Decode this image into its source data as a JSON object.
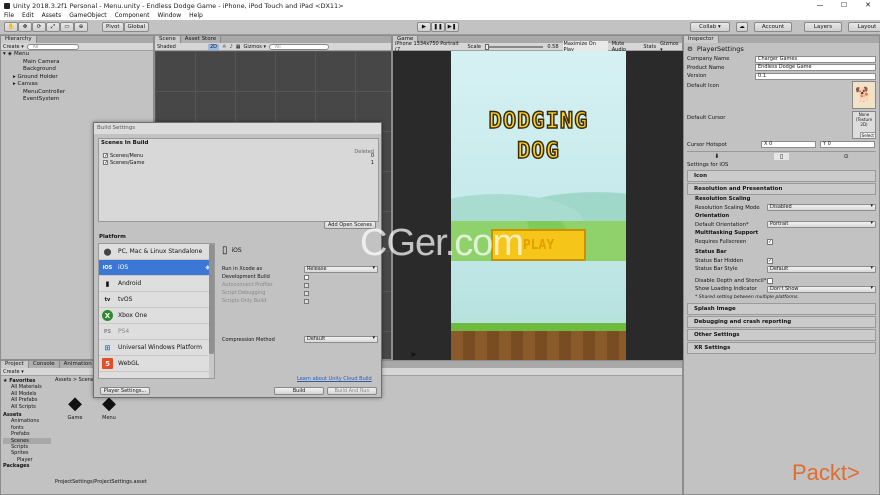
{
  "window": {
    "title": "Unity 2018.3.2f1 Personal - Menu.unity - Endless Dodge Game - iPhone, iPod Touch and iPad <DX11>",
    "controls": [
      "—",
      "☐",
      "✕"
    ]
  },
  "menu": [
    "File",
    "Edit",
    "Assets",
    "GameObject",
    "Component",
    "Window",
    "Help"
  ],
  "toolbar": {
    "pivot": "Pivot",
    "global": "Global",
    "collab": "Collab ▾",
    "account": "Account",
    "layers": "Layers",
    "layout": "Layout"
  },
  "hierarchy": {
    "tab": "Hierarchy",
    "create": "Create ▾",
    "search": "All",
    "scene": "Menu",
    "items": [
      "Main Camera",
      "Background",
      "Ground Holder",
      "Canvas",
      "MenuController",
      "EventSystem"
    ]
  },
  "scene": {
    "tab": "Scene",
    "asset_store": "Asset Store",
    "shading": "Shaded",
    "mode": "2D",
    "gizmos": "Gizmos ▾",
    "search": "All"
  },
  "game": {
    "tab": "Game",
    "resolution": "iPhone 1334x750 Portrait (7",
    "scale_label": "Scale",
    "scale_value": "0.58",
    "maximize": "Maximize On Play",
    "mute": "Mute Audio",
    "stats": "Stats",
    "gizmos": "Gizmos ▾",
    "logo_line1": "DODGING",
    "logo_line2": "DOG",
    "play": "PLAY"
  },
  "project": {
    "tabs": [
      "Project",
      "Console",
      "Animation"
    ],
    "create": "Create ▾",
    "favorites": "Favorites",
    "fav_items": [
      "All Materials",
      "All Models",
      "All Prefabs",
      "All Scripts"
    ],
    "assets": "Assets",
    "asset_items": [
      "Animations",
      "fonts",
      "Prefabs",
      "Scenes",
      "Scripts",
      "Sprites",
      "Player"
    ],
    "packages": "Packages",
    "path": "Assets > Scenes",
    "files": [
      "Game",
      "Menu"
    ],
    "status": "ProjectSettings/ProjectSettings.asset"
  },
  "build": {
    "title": "Build Settings",
    "scenes_header": "Scenes In Build",
    "deleted": "Deleted",
    "scenes": [
      {
        "name": "Scenes/Menu",
        "index": "0"
      },
      {
        "name": "Scenes/Game",
        "index": "1"
      }
    ],
    "add_open": "Add Open Scenes",
    "platform_header": "Platform",
    "platforms": [
      {
        "icon": "⬤",
        "name": "PC, Mac & Linux Standalone"
      },
      {
        "icon": "iOS",
        "name": "iOS"
      },
      {
        "icon": "▮",
        "name": "Android"
      },
      {
        "icon": "tv",
        "name": "tvOS"
      },
      {
        "icon": "X",
        "name": "Xbox One"
      },
      {
        "icon": "PS",
        "name": "PS4"
      },
      {
        "icon": "⊞",
        "name": "Universal Windows Platform"
      },
      {
        "icon": "5",
        "name": "WebGL"
      }
    ],
    "selected_name": "iOS",
    "options": [
      {
        "label": "Run in Xcode as",
        "value": "Release"
      },
      {
        "label": "Development Build",
        "value": ""
      },
      {
        "label": "Autoconnect Profiler",
        "value": ""
      },
      {
        "label": "Script Debugging",
        "value": ""
      },
      {
        "label": "Scripts Only Build",
        "value": ""
      }
    ],
    "compression_label": "Compression Method",
    "compression_value": "Default",
    "cloud_link": "Learn about Unity Cloud Build",
    "player_settings": "Player Settings...",
    "build": "Build",
    "build_run": "Build And Run"
  },
  "inspector": {
    "tab": "Inspector",
    "title": "PlayerSettings",
    "fields": [
      {
        "label": "Company Name",
        "value": "Charger Games"
      },
      {
        "label": "Product Name",
        "value": "Endless Dodge Game"
      },
      {
        "label": "Version",
        "value": "0.1"
      }
    ],
    "default_icon": "Default Icon",
    "default_cursor": "Default Cursor",
    "cursor_none": "None (Texture 2D)",
    "select": "Select",
    "cursor_hotspot": "Cursor Hotspot",
    "hotspot_x": "X 0",
    "hotspot_y": "Y 0",
    "settings_for": "Settings for iOS",
    "sections": {
      "icon": "Icon",
      "resolution": "Resolution and Presentation",
      "res_scaling": "Resolution Scaling",
      "res_scaling_mode_label": "Resolution Scaling Mode",
      "res_scaling_mode": "Disabled",
      "orientation": "Orientation",
      "default_orientation_label": "Default Orientation*",
      "default_orientation": "Portrait",
      "multitasking": "Multitasking Support",
      "requires_fullscreen": "Requires Fullscreen",
      "status_bar": "Status Bar",
      "status_bar_hidden": "Status Bar Hidden",
      "status_bar_style_label": "Status Bar Style",
      "status_bar_style": "Default",
      "disable_depth": "Disable Depth and Stencil*",
      "show_loading_label": "Show Loading Indicator",
      "show_loading": "Don't Show",
      "shared_note": "* Shared setting between multiple platforms.",
      "splash": "Splash Image",
      "debugging": "Debugging and crash reporting",
      "other": "Other Settings",
      "xr": "XR Settings"
    }
  },
  "watermarks": {
    "cger": "CGer.com",
    "packt": "Packt>"
  },
  "colors": {
    "selection": "#3d77d5",
    "panel": "#c2c2c2",
    "scene_bg": "#474747",
    "ground": "#8b5a2b",
    "grass": "#6dbb3f",
    "sky": "#cdeef0",
    "play_btn": "#f5c518",
    "logo_text": "#f7d12a",
    "packt": "#e06c2f"
  }
}
